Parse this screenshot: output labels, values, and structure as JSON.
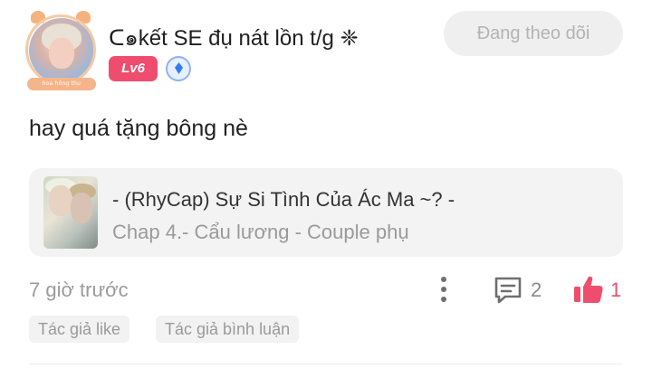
{
  "user": {
    "name": "ᑕ๑kết SE đụ nát lồn t/g ❈",
    "level": "Lv6",
    "avatar_frame_text": "hoa hồng thu"
  },
  "follow_button": {
    "label": "Đang theo dõi"
  },
  "comment": {
    "text": "hay quá tặng bông nè"
  },
  "story_card": {
    "title": "- (RhyCap) Sự Si Tình Của Ác Ma ~? -",
    "subtitle": "Chap 4.- Cẩu lương - Couple phụ"
  },
  "meta": {
    "time": "7 giờ trước",
    "comment_count": "2",
    "like_count": "1"
  },
  "tags": [
    "Tác giả like",
    "Tác giả bình luận"
  ],
  "colors": {
    "accent_pink": "#ef4d6d",
    "level_badge": "#ef4d6d",
    "verify_blue": "#2f7df6",
    "follow_bg": "#efefef",
    "muted_text": "#9a9a9a"
  },
  "icons": {
    "more": "vertical-dots-icon",
    "comment": "speech-bubble-icon",
    "like": "thumbs-up-icon",
    "verify": "diamond-badge-icon"
  }
}
